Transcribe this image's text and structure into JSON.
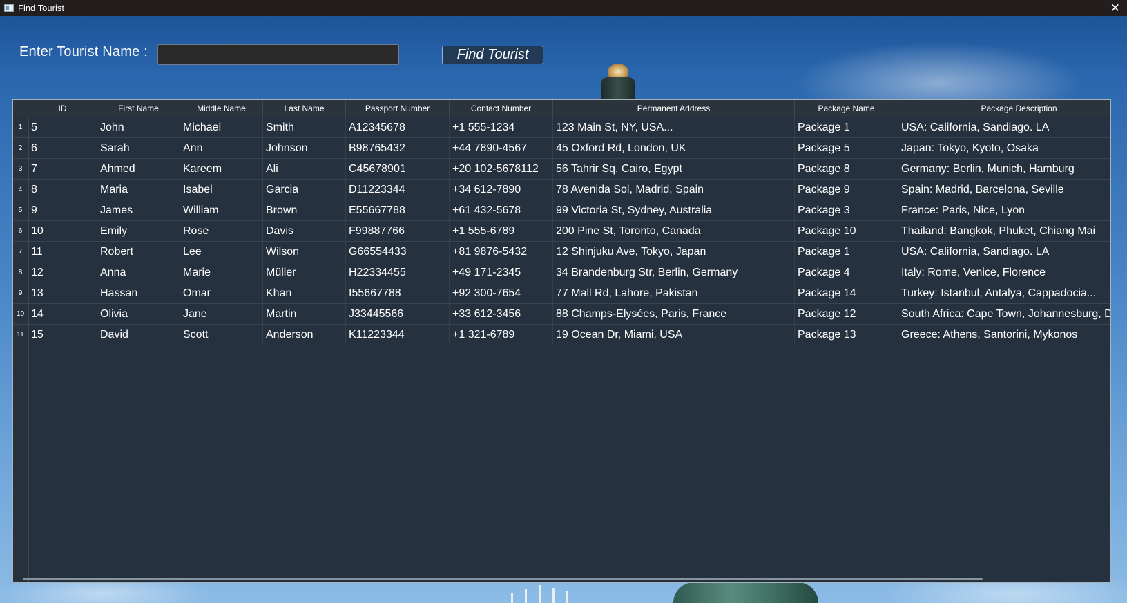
{
  "window": {
    "title": "Find Tourist",
    "close_glyph": "✕",
    "icon": "app-window-icon"
  },
  "search": {
    "label": "Enter Tourist Name :",
    "value": "",
    "placeholder": "",
    "button_label": "Find Tourist"
  },
  "table": {
    "columns": [
      "ID",
      "First Name",
      "Middle Name",
      "Last Name",
      "Passport Number",
      "Contact Number",
      "Permanent Address",
      "Package Name",
      "Package Description"
    ],
    "rows": [
      {
        "num": "1",
        "cells": [
          "5",
          "John",
          "Michael",
          "Smith",
          "A12345678",
          "+1 555-1234",
          "123 Main St, NY, USA...",
          "Package 1",
          "USA: California, Sandiago. LA"
        ]
      },
      {
        "num": "2",
        "cells": [
          "6",
          "Sarah",
          "Ann",
          "Johnson",
          "B98765432",
          "+44 7890-4567",
          "45 Oxford Rd, London, UK",
          "Package 5",
          "Japan: Tokyo, Kyoto, Osaka"
        ]
      },
      {
        "num": "3",
        "cells": [
          "7",
          "Ahmed",
          "Kareem",
          "Ali",
          "C45678901",
          "+20 102-5678112",
          "56 Tahrir Sq, Cairo, Egypt",
          "Package 8",
          "Germany: Berlin, Munich, Hamburg"
        ]
      },
      {
        "num": "4",
        "cells": [
          "8",
          "Maria",
          "Isabel",
          "Garcia",
          "D11223344",
          "+34 612-7890",
          "78 Avenida Sol, Madrid, Spain",
          "Package 9",
          "Spain: Madrid, Barcelona, Seville"
        ]
      },
      {
        "num": "5",
        "cells": [
          "9",
          "James",
          "William",
          "Brown",
          "E55667788",
          "+61 432-5678",
          "99 Victoria St, Sydney, Australia",
          "Package 3",
          "France: Paris, Nice, Lyon"
        ]
      },
      {
        "num": "6",
        "cells": [
          "10",
          "Emily",
          "Rose",
          "Davis",
          "F99887766",
          "+1 555-6789",
          "200 Pine St, Toronto, Canada",
          "Package 10",
          "Thailand: Bangkok, Phuket, Chiang Mai"
        ]
      },
      {
        "num": "7",
        "cells": [
          "11",
          "Robert",
          "Lee",
          "Wilson",
          "G66554433",
          "+81 9876-5432",
          "12 Shinjuku Ave, Tokyo, Japan",
          "Package 1",
          "USA: California, Sandiago. LA"
        ]
      },
      {
        "num": "8",
        "cells": [
          "12",
          "Anna",
          "Marie",
          "Müller",
          "H22334455",
          "+49 171-2345",
          "34 Brandenburg Str, Berlin, Germany",
          "Package 4",
          "Italy: Rome, Venice, Florence"
        ]
      },
      {
        "num": "9",
        "cells": [
          "13",
          "Hassan",
          "Omar",
          "Khan",
          "I55667788",
          "+92 300-7654",
          "77 Mall Rd, Lahore, Pakistan",
          "Package 14",
          "Turkey: Istanbul, Antalya, Cappadocia..."
        ]
      },
      {
        "num": "10",
        "cells": [
          "14",
          "Olivia",
          "Jane",
          "Martin",
          "J33445566",
          "+33 612-3456",
          "88 Champs-Elysées, Paris, France",
          "Package 12",
          "South Africa: Cape Town, Johannesburg, Dur"
        ]
      },
      {
        "num": "11",
        "cells": [
          "15",
          "David",
          "Scott",
          "Anderson",
          "K11223344",
          "+1 321-6789",
          "19 Ocean Dr, Miami, USA",
          "Package 13",
          "Greece: Athens, Santorini, Mykonos"
        ]
      }
    ]
  },
  "colors": {
    "titlebar": "#231d1e",
    "table_background": "#25313f",
    "button_background": "#223a55",
    "text": "#ffffff"
  }
}
